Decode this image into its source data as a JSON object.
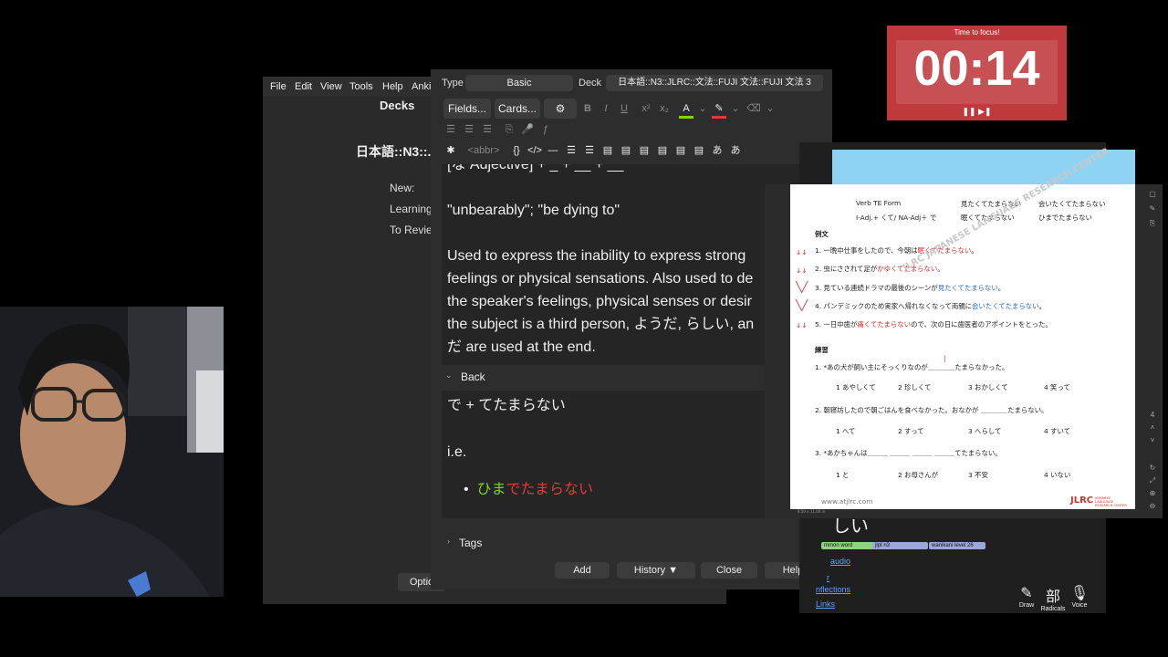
{
  "anki_main": {
    "menu": [
      "File",
      "Edit",
      "View",
      "Tools",
      "Help",
      "Anki"
    ],
    "decks_title": "Decks",
    "deck_name": "日本語::N3::..",
    "stats": [
      "New:",
      "Learning",
      "To Revie"
    ],
    "options_label": "Optio"
  },
  "editor": {
    "type_label": "Type",
    "type_value": "Basic",
    "deck_label": "Deck",
    "deck_value": "日本語::N3::JLRC::文法::FUJI 文法::FUJI 文法 3",
    "fields_button": "Fields...",
    "cards_button": "Cards...",
    "abbr_label": "<abbr>",
    "front_lines": [
      "[な Adjective] + _ + __ + __",
      "",
      "\"unbearably\"; \"be dying to\"",
      "",
      "Used to express the inability to express strong",
      "feelings or physical sensations. Also used to de",
      "the speaker's feelings, physical senses or desir",
      "the subject is a third person, ようだ, らしい, an",
      "だ are used at the end."
    ],
    "back_label": "Back",
    "back_line1": "で + てたまらない",
    "back_line2": "i.e.",
    "back_example_green": "ひま",
    "back_example_red": "でたまらない",
    "tags_label": "Tags",
    "buttons": {
      "add": "Add",
      "history": "History ▼",
      "close": "Close",
      "help": "Help"
    }
  },
  "timer": {
    "label": "Time to focus!",
    "digits": "00:14",
    "controls": "❚❚ ▶❚"
  },
  "dictionary": {
    "word": "しい",
    "tags": [
      "mmon word",
      "jlpt n3",
      "wanikani level 26"
    ],
    "links": [
      "audio",
      "r",
      "nflections",
      "Links"
    ],
    "tools": [
      "Draw",
      "Radicals",
      "Voice"
    ]
  },
  "pdf": {
    "header": [
      {
        "a": "Verb TE Form",
        "b": "見たくてたまらない",
        "c": "会いたくてたまらない"
      },
      {
        "a": "I-Adj.+  くて/ NA-Adj＋ で",
        "b": "眠くてたまらない",
        "c": "ひまでたまらない"
      }
    ],
    "example_heading": "例文",
    "examples": [
      {
        "n": "1.",
        "pre": "一晩中仕事をしたので、今朝は",
        "hl": "眠くてたまらない",
        "post": "。"
      },
      {
        "n": "2.",
        "pre": "虫にさされて足が",
        "hl": "かゆくてたまらない",
        "post": "。"
      },
      {
        "n": "3.",
        "pre": "見ている連続ドラマの最後のシーンが",
        "hl": "見たくてたまらない",
        "post": "。"
      },
      {
        "n": "4.",
        "pre": "パンデミックのため実家へ帰れなくなって両親に",
        "hl": "会いたくてたまらない",
        "post": "。"
      },
      {
        "n": "5.",
        "pre": "一日中歯が",
        "hl": "痛くてたまらない",
        "post": "ので、次の日に歯医者のアポイントをとった。"
      }
    ],
    "practice_heading": "練習",
    "q1": "1. *あの犬が飼い主にそっくりなのが＿＿＿＿たまらなかった。",
    "q1_opts": [
      "1 あやしくて",
      "2 珍しくて",
      "3 おかしくて",
      "4 笑って"
    ],
    "q2": "2. 朝寝坊したので朝ごはんを食べなかった。おなかが ＿＿＿＿たまらない。",
    "q2_opts": [
      "1 へて",
      "2 すって",
      "3 へらして",
      "4 すいて"
    ],
    "q3": "3. *あかちゃんは＿＿＿  ＿＿＿  ＿＿＿  ＿＿＿てたまらない。",
    "q3_opts": [
      "1 と",
      "2 お母さんが",
      "3 不安",
      "4 いない"
    ],
    "footer_url": "www.atjlrc.com",
    "footer_logo": "JLRC",
    "footer_logo_sub": "JAPANESE LANGUAGE RESEARCH CENTER",
    "watermark": "JLRC JAPANESE LANGUAGE RESEARCH CENTER",
    "zoom": "8.50 x 11.00 in"
  }
}
